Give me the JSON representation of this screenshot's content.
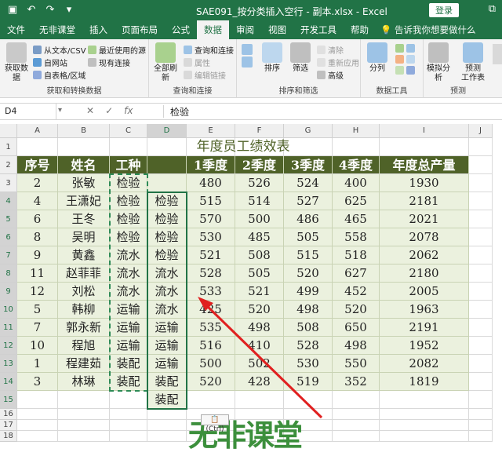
{
  "title_bar": {
    "filename": "SAE091_按分类插入空行 - 副本.xlsx - Excel",
    "login_label": "登录",
    "restore_icon": "restore-icon"
  },
  "tabs": [
    "文件",
    "无非课堂",
    "插入",
    "页面布局",
    "公式",
    "数据",
    "审阅",
    "视图",
    "开发工具",
    "帮助"
  ],
  "active_tab": "数据",
  "tell_me": "告诉我你想要做什么",
  "ribbon": {
    "get_data_label": "获取数据",
    "from_text": "从文本/CSV",
    "from_web": "自网站",
    "from_table": "自表格/区域",
    "recent_sources": "最近使用的源",
    "existing_connections": "现有连接",
    "group1": "获取和转换数据",
    "refresh_all": "全部刷新",
    "queries_connections": "查询和连接",
    "properties": "属性",
    "edit_links": "编辑链接",
    "group2": "查询和连接",
    "sort": "排序",
    "filter": "筛选",
    "clear": "清除",
    "reapply": "重新应用",
    "advanced": "高级",
    "group3": "排序和筛选",
    "split": "分列",
    "group4": "数据工具",
    "what_if": "模拟分析",
    "forecast_sheet": "预测\n工作表",
    "group5": "预测"
  },
  "formula_bar": {
    "name_box": "D4",
    "formula": "检验"
  },
  "columns": [
    "A",
    "B",
    "C",
    "D",
    "E",
    "F",
    "G",
    "H",
    "I",
    "J"
  ],
  "rows": [
    "1",
    "2",
    "3",
    "4",
    "5",
    "6",
    "7",
    "8",
    "9",
    "10",
    "11",
    "12",
    "13",
    "14",
    "15",
    "16",
    "17",
    "18"
  ],
  "sheet": {
    "title": "年度员工绩效表",
    "headers": [
      "序号",
      "姓名",
      "工种",
      "",
      "1季度",
      "2季度",
      "3季度",
      "4季度",
      "年度总产量"
    ],
    "data": [
      [
        "2",
        "张敏",
        "检验",
        "",
        "480",
        "526",
        "524",
        "400",
        "1930"
      ],
      [
        "4",
        "王潇妃",
        "检验",
        "检验",
        "515",
        "514",
        "527",
        "625",
        "2181"
      ],
      [
        "6",
        "王冬",
        "检验",
        "检验",
        "570",
        "500",
        "486",
        "465",
        "2021"
      ],
      [
        "8",
        "吴明",
        "检验",
        "检验",
        "530",
        "485",
        "505",
        "558",
        "2078"
      ],
      [
        "9",
        "黄鑫",
        "流水",
        "检验",
        "521",
        "508",
        "515",
        "518",
        "2062"
      ],
      [
        "11",
        "赵菲菲",
        "流水",
        "流水",
        "528",
        "505",
        "520",
        "627",
        "2180"
      ],
      [
        "12",
        "刘松",
        "流水",
        "流水",
        "533",
        "521",
        "499",
        "452",
        "2005"
      ],
      [
        "5",
        "韩柳",
        "运输",
        "流水",
        "425",
        "520",
        "498",
        "520",
        "1963"
      ],
      [
        "7",
        "郭永新",
        "运输",
        "运输",
        "535",
        "498",
        "508",
        "650",
        "2191"
      ],
      [
        "10",
        "程旭",
        "运输",
        "运输",
        "516",
        "410",
        "528",
        "498",
        "1952"
      ],
      [
        "1",
        "程建茹",
        "装配",
        "运输",
        "500",
        "502",
        "530",
        "550",
        "2082"
      ],
      [
        "3",
        "林琳",
        "装配",
        "装配",
        "520",
        "428",
        "519",
        "352",
        "1819"
      ]
    ],
    "d15": "装配"
  },
  "paste_badge": "(Ctrl)",
  "watermark": "无非课堂",
  "colors": {
    "header_bg": "#4f6228",
    "data_bg": "#ebf1de",
    "excel_green": "#217346",
    "arrow": "#e02020"
  }
}
